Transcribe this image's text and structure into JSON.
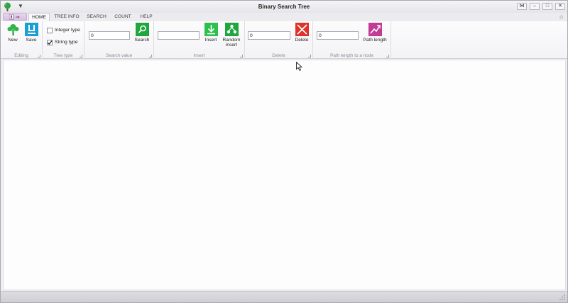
{
  "window": {
    "title": "Binary Search Tree",
    "controls": {
      "pin": "⋈",
      "minimize": "–",
      "maximize": "□",
      "close": "✕"
    }
  },
  "quick_access": {
    "arrow": "▼"
  },
  "tabs": [
    {
      "label": "HOME",
      "active": true
    },
    {
      "label": "TREE INFO",
      "active": false
    },
    {
      "label": "SEARCH",
      "active": false
    },
    {
      "label": "COUNT",
      "active": false
    },
    {
      "label": "HELP",
      "active": false
    }
  ],
  "ribbon_collapse": "⌂",
  "groups": {
    "editing": {
      "label": "Editing",
      "new_label": "New",
      "save_label": "Save",
      "new_icon": "tree-icon",
      "save_icon": "floppy-icon"
    },
    "tree_type": {
      "label": "Tree type",
      "integer_label": "Integer type",
      "integer_checked": false,
      "string_label": "String type",
      "string_checked": true
    },
    "search_value": {
      "label": "Search value",
      "input_value": "0",
      "search_label": "Search",
      "search_icon": "magnifier-icon"
    },
    "insert": {
      "label": "Insert",
      "input_value": "",
      "insert_label": "Insert",
      "random_insert_label_1": "Random",
      "random_insert_label_2": "insert",
      "insert_icon": "down-arrow-icon",
      "random_icon": "nodes-icon"
    },
    "delete": {
      "label": "Delete",
      "input_value": "0",
      "delete_label": "Delete",
      "delete_icon": "x-icon"
    },
    "path_length": {
      "label": "Path length to a node",
      "input_value": "0",
      "path_label": "Path length",
      "path_icon": "path-icon"
    }
  },
  "colors": {
    "green": "#1fa63d",
    "teal": "#1a9fd4",
    "red": "#e0312b",
    "magenta": "#c23b96",
    "file_tab": "#d8bfe0"
  }
}
